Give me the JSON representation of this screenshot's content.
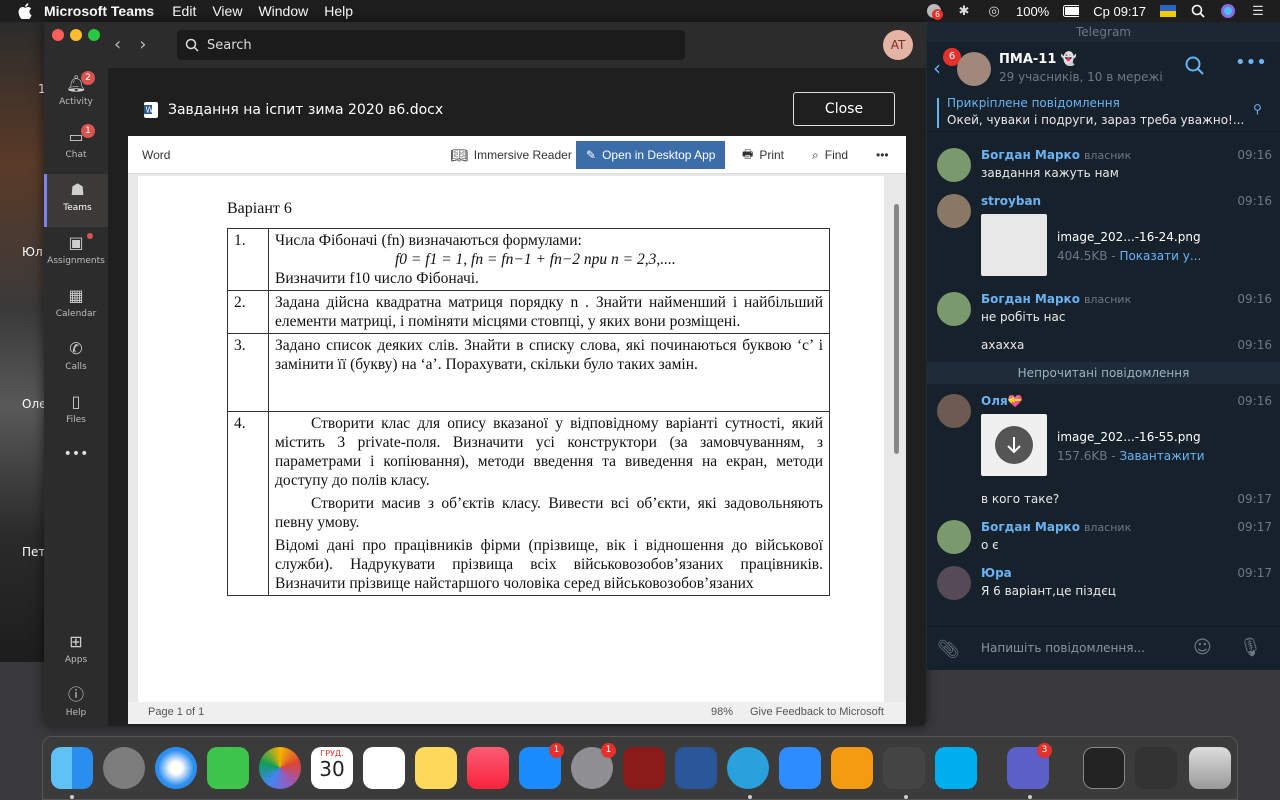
{
  "menubar": {
    "app_name": "Microsoft Teams",
    "menus": [
      "Edit",
      "View",
      "Window",
      "Help"
    ],
    "battery": "100%",
    "clock": "Ср 09:17",
    "notif_badge": "6"
  },
  "background_names": [
    "1",
    "Юл",
    "Оле",
    "Пет"
  ],
  "teams": {
    "search_placeholder": "Search",
    "avatar_initials": "AT",
    "rail": [
      {
        "label": "Activity",
        "badge": "2"
      },
      {
        "label": "Chat",
        "badge": "1"
      },
      {
        "label": "Teams",
        "badge": ""
      },
      {
        "label": "Assignments",
        "badge": ""
      },
      {
        "label": "Calendar",
        "badge": ""
      },
      {
        "label": "Calls",
        "badge": ""
      },
      {
        "label": "Files",
        "badge": ""
      },
      {
        "label": "•••",
        "badge": ""
      },
      {
        "label": "Apps",
        "badge": ""
      },
      {
        "label": "Help",
        "badge": ""
      }
    ],
    "doc_title": "Завдання на іспит зима 2020 в6.docx",
    "close_label": "Close",
    "word": {
      "label": "Word",
      "immersive_reader": "Immersive Reader",
      "open_desktop": "Open in Desktop App",
      "print": "Print",
      "find": "Find",
      "more": "•••"
    },
    "status": {
      "page": "Page 1 of 1",
      "zoom": "98%",
      "feedback": "Give Feedback to Microsoft"
    }
  },
  "document": {
    "variant": "Варіант 6",
    "rows": [
      {
        "num": "1.",
        "lines": [
          "Числа Фібоначі (fn) визначаються формулами:",
          "f0 = f1 = 1,   fn = fn−1 + fn−2  при n = 2,3,....",
          "Визначити  f10  число Фібоначі."
        ]
      },
      {
        "num": "2.",
        "lines": [
          "Задана дійсна квадратна матриця порядку  n . Знайти найменший і найбільший елементи матриці, і поміняти місцями стовпці, у яких вони розміщені."
        ]
      },
      {
        "num": "3.",
        "lines": [
          "Задано список деяких слів. Знайти в списку слова, які починаються буквою ‘с’ і замінити її (букву) на  ‘а’. Порахувати, скільки було таких замін."
        ]
      },
      {
        "num": "4.",
        "lines": [
          "Створити клас для опису вказаної у відповідному варіанті сутності, який містить 3 private-поля. Визначити усі конструктори (за замовчуванням, з параметрами і копіювання), методи введення та виведення на екран, методи доступу до полів класу.",
          "Створити масив з об’єктів класу. Вивести всі об’єкти, які задовольняють певну умову.",
          "Відомі дані про працівників фірми (прізвище, вік і відношення до військової служби). Надрукувати прізвища всіх військовозобов’язаних працівників. Визначити прізвище найстаршого чоловіка серед військовозобов’язаних"
        ]
      }
    ]
  },
  "telegram": {
    "window_title": "Telegram",
    "back_badge": "6",
    "chat_name": "ПМА-11 👻",
    "chat_sub": "29 учасників, 10 в мережі",
    "pinned_label": "Прикріплене повідомлення",
    "pinned_text": "Окей, чуваки і подруги, зараз треба уважно!...",
    "messages": [
      {
        "name": "Богдан Марко",
        "role": "власник",
        "time": "09:16",
        "text": "завдання кажуть нам"
      },
      {
        "name": "stroyban",
        "role": "",
        "time": "09:16",
        "file": "image_202...-16-24.png",
        "size": "404.5KB",
        "action": "Показати у..."
      },
      {
        "name": "Богдан Марко",
        "role": "власник",
        "time": "09:16",
        "text": "не робіть нас"
      },
      {
        "name": "",
        "role": "",
        "time": "09:16",
        "text": "ахахха"
      },
      {
        "name": "Оля💝",
        "role": "",
        "time": "09:16",
        "file": "image_202...-16-55.png",
        "size": "157.6KB",
        "action": "Завантажити"
      },
      {
        "name": "",
        "role": "",
        "time": "09:17",
        "text": "в кого таке?"
      },
      {
        "name": "Богдан Марко",
        "role": "власник",
        "time": "09:17",
        "text": "о є"
      },
      {
        "name": "Юра",
        "role": "",
        "time": "09:17",
        "text": "Я 6 варіант,це піздєц"
      }
    ],
    "unread_label": "Непрочитані повідомлення",
    "composer_placeholder": "Напишіть повідомлення..."
  },
  "dock": {
    "calendar_month": "ГРУД.",
    "calendar_day": "30",
    "badges": {
      "appstore": "1",
      "sysprefs": "1",
      "teams": "3"
    }
  }
}
